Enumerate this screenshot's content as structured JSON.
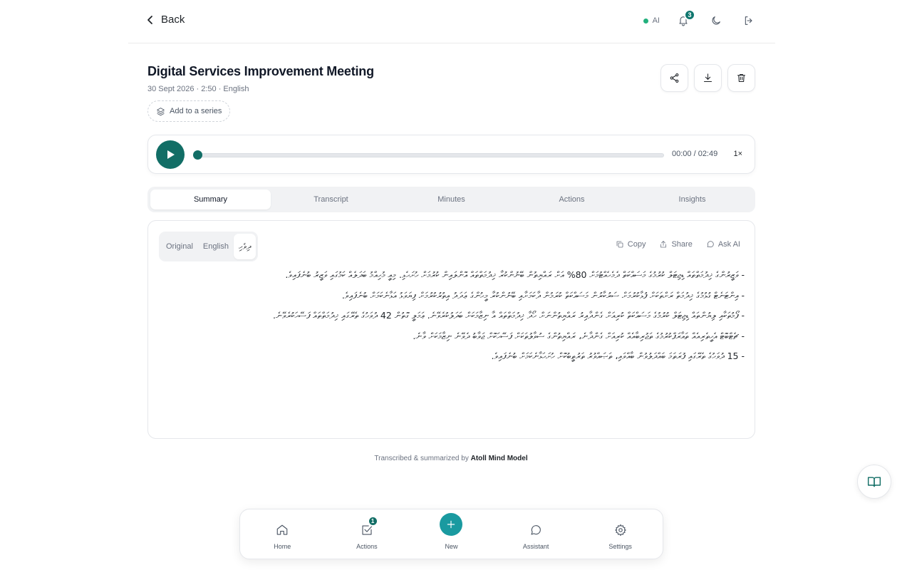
{
  "topbar": {
    "back_label": "Back",
    "ai_status": "AI",
    "ai_status_color": "#22b07d",
    "notification_count": "3"
  },
  "meeting": {
    "title": "Digital Services Improvement Meeting",
    "meta": "30 Sept 2026 · 2:50 · English",
    "add_series_label": "Add to a series"
  },
  "player": {
    "time": "00:00 / 02:49",
    "speed": "1×",
    "progress": 0
  },
  "tabs": [
    {
      "label": "Summary",
      "active": true
    },
    {
      "label": "Transcript",
      "active": false
    },
    {
      "label": "Minutes",
      "active": false
    },
    {
      "label": "Actions",
      "active": false
    },
    {
      "label": "Insights",
      "active": false
    }
  ],
  "summary_card": {
    "languages": [
      "Original",
      "English",
      "ދިވެހި"
    ],
    "active_language": "ދިވެހި",
    "actions": {
      "copy": "Copy",
      "share": "Share",
      "ask_ai": "Ask AI"
    },
    "items": [
      "- ވަޒީރުންގެ ޚިދުމަތްތައް ޑިޖިޓަލް ކުރުމުގެ މަސައްކަތް ދެމެހެއްޓުމަށް 80% އަށް ރައްޔިތުން ބޭނުންކުރާ ޚިދުމަތްތައް އޮންލައިން ކުރުމަށް ހުށަހެޅި. މިއީ މުހިއްމު ބަދަލެއް ކަމުގައި ވަޒީރު ބުނެފައިވެ.",
      "- އިންޓަނެޓް ގުޅުމުގެ ޚިދުމަތް ރަށްތަކަށް ފުޅާކުރުމަށް ސަރުކާރުން މަސައްކަތް ކުރަމުން ދާކަމަށާއި ބޭނުންކުރާ މީހުންގެ ޢަދަދު އިތުރުކުރުމަށް ފިޔަވަޅު އަޅާނެކަމަށް ބުނެފައިވެ.",
      "- ފޯމުތަކާއި ލިޔުންތައް ޑިޖިޓަލް ކުރުމުގެ މަސައްކަތް ކުރިއަށް ގެންދާއިރު ރައްޔިތުންނަށް ހޯދާ ޚިދުމަތްތައް އާ ނިޒާމަކަށް ބަދަލުކުރެވޭނެ. ޢަމަލީ ގޮތުން 42 ދުވަހުގެ ތެރޭގައި ޚިދުމަތްތައް ފަސޭހަކުރެވޭނެ.",
      "- ޗެޓްބޮޓް އެހީތެރިއެއް ތައާރަފްކުރުމުގެ ތަޖުރިބާއެއް ކުރިއަށް ގެންދާނެ، ރައްޔިތުންގެ ސުވާލުތަކަށް ފަސޭހަކޮށް ޖަވާބު ދެވޭނެ ނިޒާމަކަށް ވާނެ.",
      "- 15 ދުވަހުގެ ތެރޭގައި ފުރަތަމަ ބައްދަލުވުން ބާއްވައި، ތަޞައްވުރު ތަރުތީބުކޮށް ހުށަހަޅާނެކަމަށް ބުނެފައިވެ."
    ]
  },
  "footer": {
    "prefix": "Transcribed & summarized by",
    "model": "Atoll Mind Model"
  },
  "bottom_nav": [
    {
      "label": "Home",
      "icon": "home-icon"
    },
    {
      "label": "Actions",
      "icon": "checkbox-icon",
      "badge": "1"
    },
    {
      "label": "New",
      "icon": "plus-icon"
    },
    {
      "label": "Assistant",
      "icon": "chat-icon"
    },
    {
      "label": "Settings",
      "icon": "gear-icon"
    }
  ],
  "colors": {
    "accent": "#126e66",
    "accent_light": "#1a9aa0"
  }
}
